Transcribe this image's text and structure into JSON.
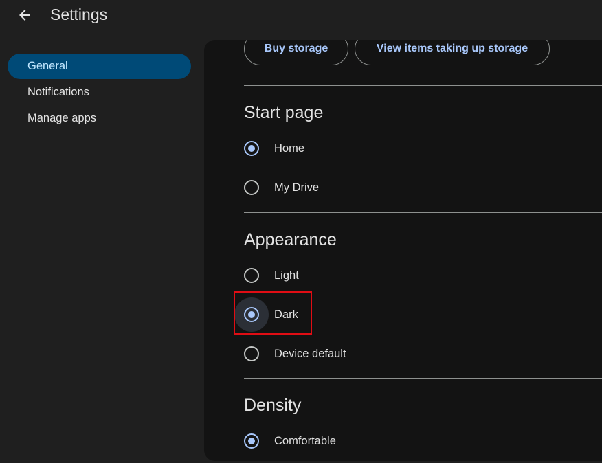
{
  "header": {
    "title": "Settings",
    "back_icon": "arrow-left-icon"
  },
  "sidebar": {
    "items": [
      {
        "label": "General",
        "active": true
      },
      {
        "label": "Notifications",
        "active": false
      },
      {
        "label": "Manage apps",
        "active": false
      }
    ]
  },
  "storage": {
    "buy_label": "Buy storage",
    "view_label": "View items taking up storage"
  },
  "start_page": {
    "title": "Start page",
    "options": [
      {
        "label": "Home",
        "checked": true
      },
      {
        "label": "My Drive",
        "checked": false
      }
    ]
  },
  "appearance": {
    "title": "Appearance",
    "options": [
      {
        "label": "Light",
        "checked": false
      },
      {
        "label": "Dark",
        "checked": true,
        "highlighted": true
      },
      {
        "label": "Device default",
        "checked": false
      }
    ]
  },
  "density": {
    "title": "Density",
    "options": [
      {
        "label": "Comfortable",
        "checked": true
      }
    ]
  },
  "colors": {
    "background": "#1f1f1f",
    "panel": "#131313",
    "nav_active_bg": "#004a77",
    "nav_active_text": "#c2e7ff",
    "accent": "#a8c7fa",
    "highlight_border": "#e00d14"
  }
}
